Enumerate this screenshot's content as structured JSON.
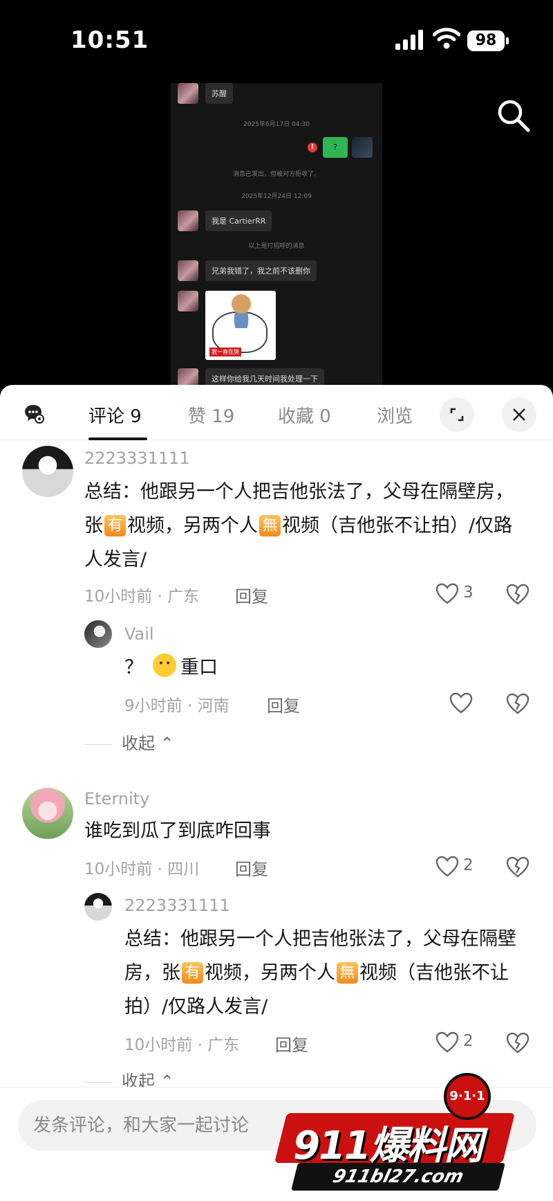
{
  "status_bar": {
    "time": "10:51",
    "battery": "98"
  },
  "chat_screenshot": {
    "items": [
      {
        "type": "msg",
        "text": "苏醒"
      },
      {
        "type": "note",
        "text": "2025年6月17日 04:30"
      },
      {
        "type": "self",
        "text": "?"
      },
      {
        "type": "note",
        "text": "消息已发出，但被对方拒收了。"
      },
      {
        "type": "note",
        "text": "2025年12月24日 12:09"
      },
      {
        "type": "msg",
        "text": "我是 CartierRR"
      },
      {
        "type": "note",
        "text": "以上是打招呼的消息"
      },
      {
        "type": "msg",
        "text": "兄弟我错了，我之前不该删你"
      },
      {
        "type": "sticker",
        "text": "我一直在哭"
      },
      {
        "type": "msg",
        "text": "这样你给我几天时间我处理一下"
      }
    ]
  },
  "tabs": [
    {
      "label": "评论 9",
      "active": true
    },
    {
      "label": "赞 19",
      "active": false
    },
    {
      "label": "收藏 0",
      "active": false
    },
    {
      "label": "浏览",
      "active": false
    }
  ],
  "comments": [
    {
      "username": "2223331111",
      "text_parts": [
        "总结：他跟另一个人把吉他张法了，父母在隔壁房，张",
        "有",
        "视频，另两个人",
        "無",
        "视频（吉他张不让拍）/仅路人发言/"
      ],
      "time_location": "10小时前 · 广东",
      "reply_label": "回复",
      "likes": "3",
      "replies": [
        {
          "username": "Vail",
          "text_before": "？",
          "text_after": "重口",
          "time_location": "9小时前 · 河南",
          "reply_label": "回复",
          "likes": ""
        }
      ],
      "collapse_label": "收起"
    },
    {
      "username": "Eternity",
      "text": "谁吃到瓜了到底咋回事",
      "time_location": "10小时前 · 四川",
      "reply_label": "回复",
      "likes": "2",
      "replies": [
        {
          "username": "2223331111",
          "text_parts": [
            "总结：他跟另一个人把吉他张法了，父母在隔壁房，张",
            "有",
            "视频，另两个人",
            "無",
            "视频（吉他张不让拍）/仅路人发言/"
          ],
          "time_location": "10小时前 · 广东",
          "reply_label": "回复",
          "likes": "2"
        }
      ],
      "collapse_label": "收起"
    }
  ],
  "input": {
    "placeholder": "发条评论，和大家一起讨论"
  },
  "watermark": {
    "title": "911爆料网",
    "url": "911bl27.com",
    "badge": "9·1·1"
  }
}
